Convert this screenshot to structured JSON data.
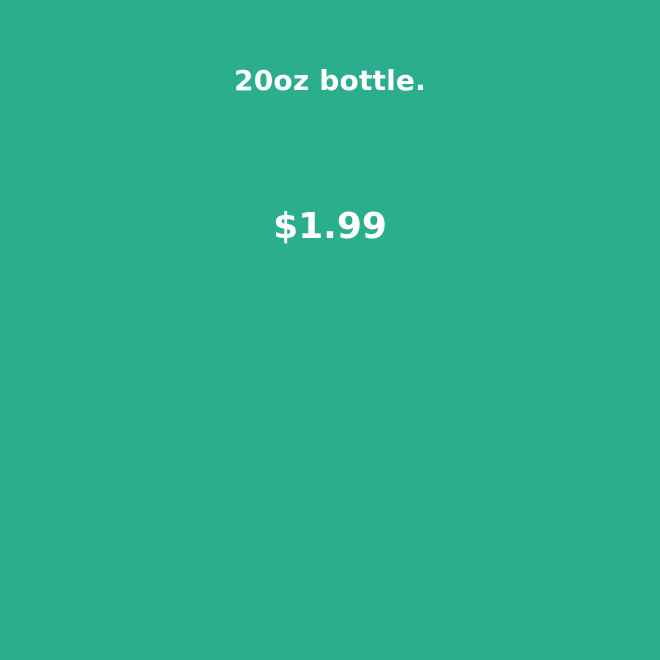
{
  "product": {
    "description": "20oz bottle.",
    "price": "$1.99"
  },
  "colors": {
    "background": "#2bae8d",
    "text": "#ffffff"
  }
}
